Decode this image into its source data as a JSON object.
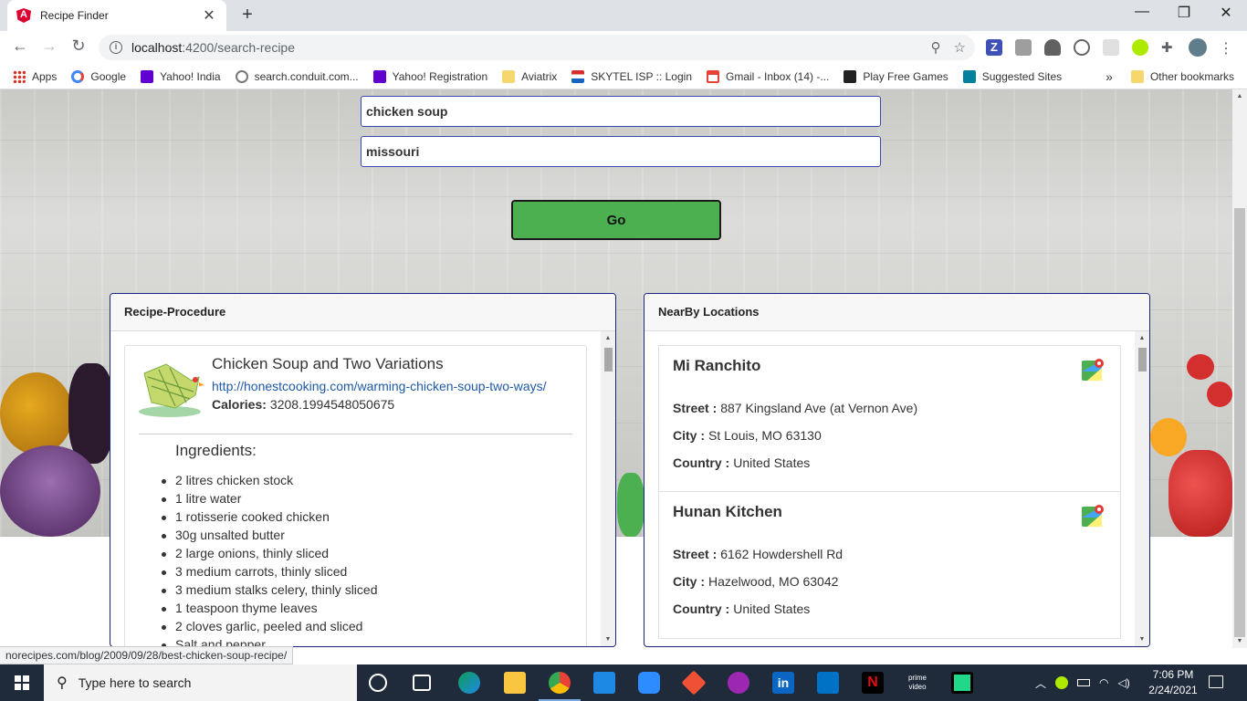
{
  "browser": {
    "tab_title": "Recipe Finder",
    "url_host": "localhost",
    "url_path": ":4200/search-recipe",
    "bookmarks": [
      {
        "label": "Apps",
        "icon": "apps-grid-icon",
        "color": "#d93025"
      },
      {
        "label": "Google",
        "icon": "google-icon",
        "color": "#4285f4"
      },
      {
        "label": "Yahoo! India",
        "icon": "yahoo-icon",
        "color": "#6001d2"
      },
      {
        "label": "search.conduit.com...",
        "icon": "search-icon",
        "color": "#777777"
      },
      {
        "label": "Yahoo! Registration",
        "icon": "yahoo-icon",
        "color": "#6001d2"
      },
      {
        "label": "Aviatrix",
        "icon": "folder-icon",
        "color": "#f5d76e"
      },
      {
        "label": "SKYTEL ISP :: Login",
        "icon": "flag-icon",
        "color": "#d32f2f"
      },
      {
        "label": "Gmail - Inbox (14) -...",
        "icon": "gmail-icon",
        "color": "#ea4335"
      },
      {
        "label": "Play Free Games",
        "icon": "games-icon",
        "color": "#222222"
      },
      {
        "label": "Suggested Sites",
        "icon": "bing-icon",
        "color": "#00809d"
      }
    ],
    "more_bookmarks": "»",
    "other_bookmarks": "Other bookmarks",
    "status_url": "norecipes.com/blog/2009/09/28/best-chicken-soup-recipe/"
  },
  "search": {
    "recipe_value": "chicken soup",
    "location_value": "missouri",
    "go_label": "Go"
  },
  "recipe_panel": {
    "header": "Recipe-Procedure",
    "title": "Chicken Soup and Two Variations",
    "link": "http://honestcooking.com/warming-chicken-soup-two-ways/",
    "calories_label": "Calories:",
    "calories_value": "3208.1994548050675",
    "ingredients_title": "Ingredients:",
    "ingredients": [
      "2 litres chicken stock",
      "1 litre water",
      "1 rotisserie cooked chicken",
      "30g unsalted butter",
      "2 large onions, thinly sliced",
      "3 medium carrots, thinly sliced",
      "3 medium stalks celery, thinly sliced",
      "1 teaspoon thyme leaves",
      "2 cloves garlic, peeled and sliced",
      "Salt and pepper"
    ]
  },
  "locations_panel": {
    "header": "NearBy Locations",
    "street_label": "Street :",
    "city_label": "City :",
    "country_label": "Country :",
    "locations": [
      {
        "name": "Mi Ranchito",
        "street": "887 Kingsland Ave (at Vernon Ave)",
        "city": "St Louis, MO 63130",
        "country": "United States"
      },
      {
        "name": "Hunan Kitchen",
        "street": "6162 Howdershell Rd",
        "city": "Hazelwood, MO 63042",
        "country": "United States"
      }
    ]
  },
  "taskbar": {
    "search_placeholder": "Type here to search",
    "time": "7:06 PM",
    "date": "2/24/2021"
  },
  "colors": {
    "go_button": "#4caf50",
    "panel_border": "#1a237e",
    "link": "#1e5aa8"
  }
}
